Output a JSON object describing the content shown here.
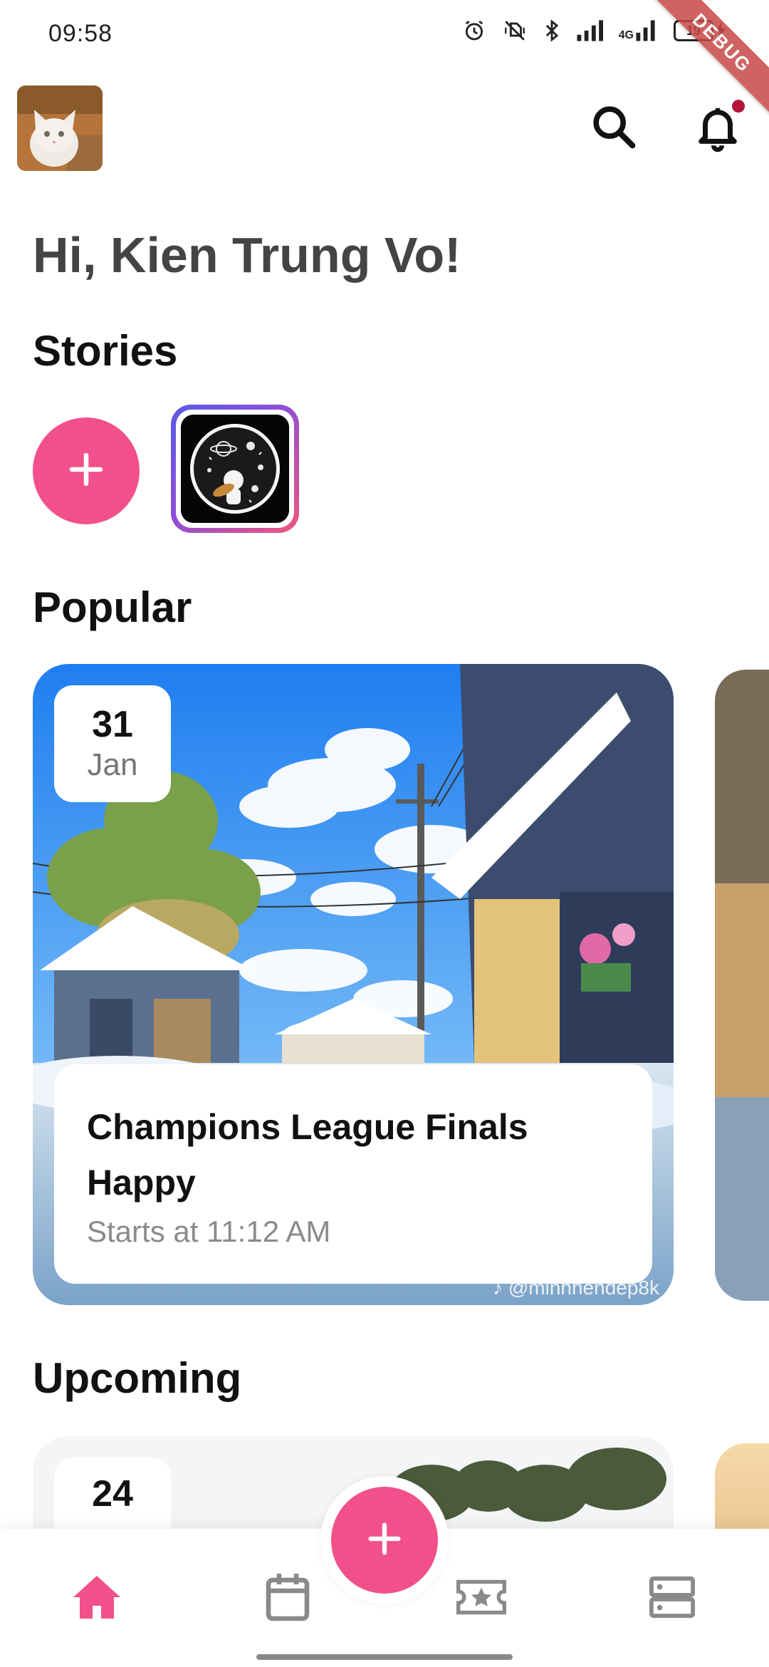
{
  "status_bar": {
    "time": "09:58",
    "battery": "19",
    "network": "4G",
    "debug_label": "DEBUG"
  },
  "header": {
    "avatar_icon": "cat-avatar",
    "search_icon": "search-icon",
    "notification_icon": "bell-icon"
  },
  "greeting": "Hi, Kien Trung Vo!",
  "stories": {
    "title": "Stories",
    "add_icon": "plus-icon"
  },
  "popular": {
    "title": "Popular",
    "events": [
      {
        "day": "31",
        "month": "Jan",
        "title_line1": "Champions League Finals",
        "title_line2": "Happy",
        "time": "Starts at 11:12 AM",
        "watermark": "♪ @minhhendep8k"
      }
    ]
  },
  "upcoming": {
    "title": "Upcoming",
    "events": [
      {
        "day": "24"
      }
    ]
  },
  "bottom_nav": {
    "items": [
      "home-icon",
      "calendar-icon",
      "ticket-icon",
      "storage-icon"
    ],
    "fab_icon": "plus-icon",
    "active": "home-icon"
  },
  "colors": {
    "accent": "#f2508a",
    "text_primary": "#111111",
    "text_secondary": "#8a8a8a"
  }
}
